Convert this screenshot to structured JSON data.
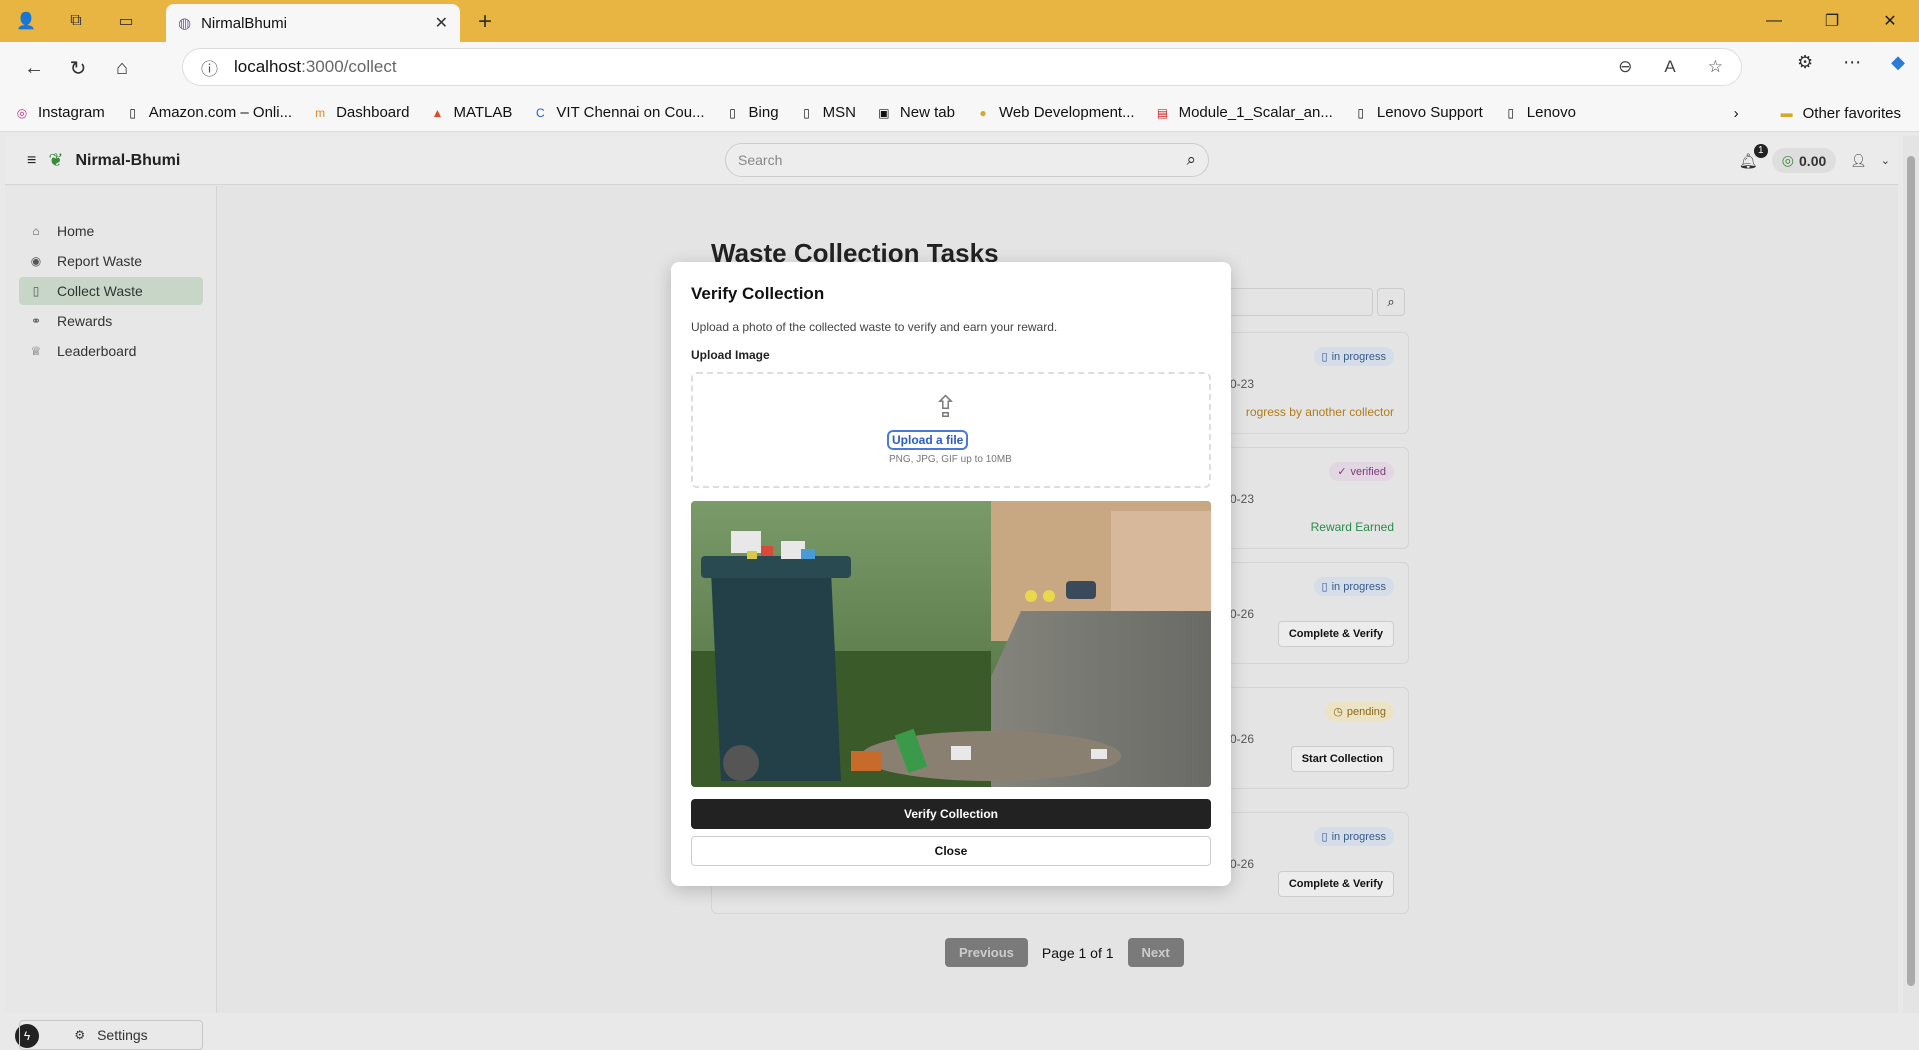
{
  "browser": {
    "tab_title": "NirmalBhumi",
    "url_host": "localhost",
    "url_path": ":3000/collect",
    "bookmarks": [
      "Instagram",
      "Amazon.com – Onli...",
      "Dashboard",
      "MATLAB",
      "VIT Chennai on Cou...",
      "Bing",
      "MSN",
      "New tab",
      "Web Development...",
      "Module_1_Scalar_an...",
      "Lenovo Support",
      "Lenovo"
    ],
    "other_favorites": "Other favorites"
  },
  "header": {
    "brand": "Nirmal-Bhumi",
    "search_placeholder": "Search",
    "notif_count": "1",
    "balance": "0.00"
  },
  "sidebar": {
    "items": [
      {
        "label": "Home",
        "icon": "home-icon"
      },
      {
        "label": "Report Waste",
        "icon": "map-pin-icon"
      },
      {
        "label": "Collect Waste",
        "icon": "trash-icon"
      },
      {
        "label": "Rewards",
        "icon": "coins-icon"
      },
      {
        "label": "Leaderboard",
        "icon": "medal-icon"
      }
    ],
    "settings": "Settings"
  },
  "main": {
    "title": "Waste Collection Tasks",
    "cards": [
      {
        "status": "in progress",
        "date": "0-23",
        "note": "rogress by another collector",
        "action": ""
      },
      {
        "status": "verified",
        "date": "0-23",
        "note": "Reward Earned",
        "action": ""
      },
      {
        "status": "in progress",
        "date": "0-26",
        "note": "",
        "action": "Complete & Verify"
      },
      {
        "status": "pending",
        "date": "0-26",
        "note": "",
        "action": "Start Collection"
      },
      {
        "status": "in progress",
        "date": "0-26",
        "note": "",
        "action": "Complete & Verify"
      }
    ],
    "pager": {
      "prev": "Previous",
      "page": "Page 1 of 1",
      "next": "Next"
    }
  },
  "modal": {
    "title": "Verify Collection",
    "description": "Upload a photo of the collected waste to verify and earn your reward.",
    "upload_label": "Upload Image",
    "upload_link": "Upload a file",
    "upload_hint": "PNG, JPG, GIF up to 10MB",
    "verify_button": "Verify Collection",
    "close_button": "Close"
  },
  "colors": {
    "accent": "#222222",
    "brand_green": "#3a8a3a",
    "titlebar": "#e8b543"
  }
}
